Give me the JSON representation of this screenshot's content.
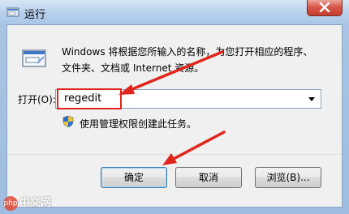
{
  "window": {
    "title": "运行",
    "close_icon": "close-icon"
  },
  "main": {
    "description": "Windows 将根据您所输入的名称，为您打开相应的程序、文件夹、文档或 Internet 资源。",
    "open_label": "打开(O):",
    "command_value": "regedit",
    "admin_note": "使用管理权限创建此任务。"
  },
  "buttons": {
    "ok": "确定",
    "cancel": "取消",
    "browse": "浏览(B)..."
  },
  "watermark": {
    "logo_text": "php",
    "text": "中文网"
  },
  "colors": {
    "annotation_red": "#e0261b",
    "titlebar": "#b8d0ec",
    "close_button": "#d8574a"
  }
}
